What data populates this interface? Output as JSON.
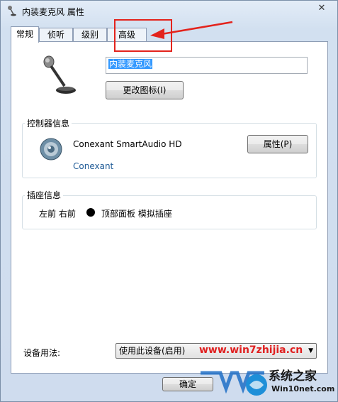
{
  "window": {
    "title": "内装麦克风 属性",
    "close_glyph": "✕"
  },
  "tabs": [
    {
      "label": "常规",
      "active": true
    },
    {
      "label": "侦听",
      "active": false
    },
    {
      "label": "级别",
      "active": false
    },
    {
      "label": "高级",
      "active": false
    }
  ],
  "general": {
    "device_name": "内装麦克风",
    "change_icon_label": "更改图标(I)"
  },
  "controller": {
    "group_label": "控制器信息",
    "name": "Conexant SmartAudio HD",
    "vendor": "Conexant",
    "properties_label": "属性(P)"
  },
  "jack": {
    "group_label": "插座信息",
    "position": "左前 右前",
    "description": "顶部面板 模拟插座",
    "dot_color": "#000000"
  },
  "usage": {
    "label": "设备用法:",
    "selected": "使用此设备(启用)"
  },
  "footer": {
    "ok_label": "确定"
  },
  "annotation": {
    "color": "#e3231c"
  },
  "watermarks": {
    "url": "www.win7zhijia.cn",
    "site_name": "系统之家",
    "site_url": "Win10net.com"
  }
}
